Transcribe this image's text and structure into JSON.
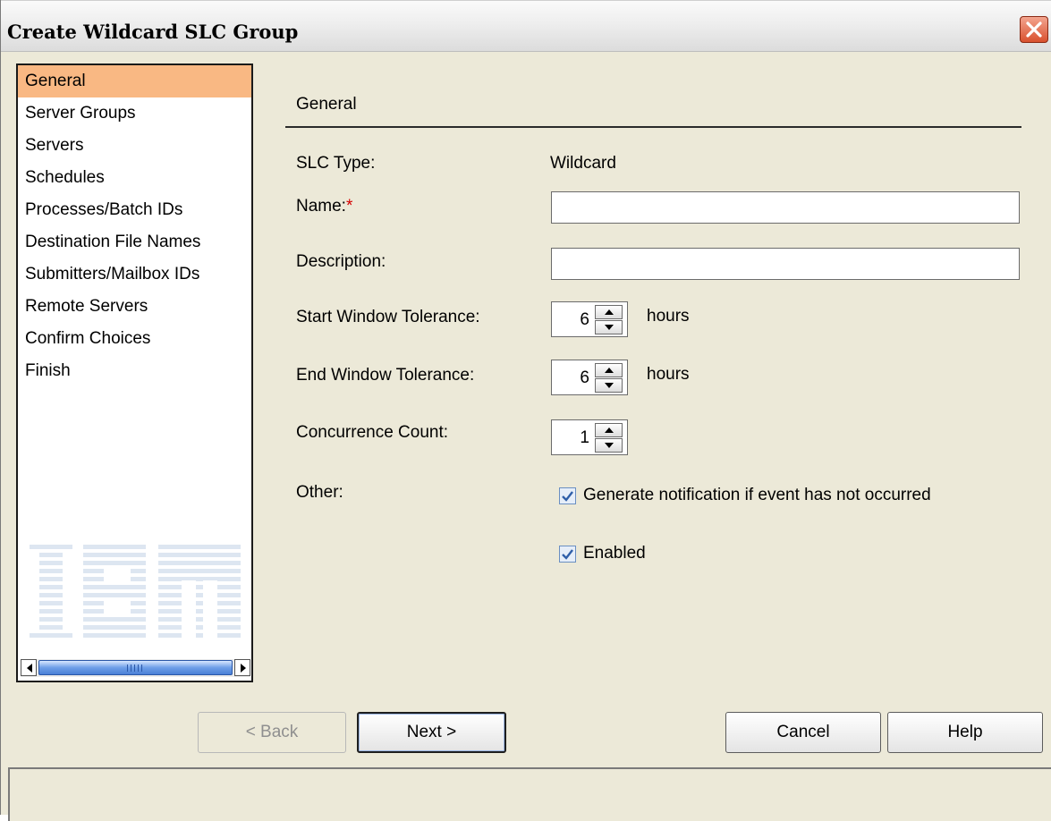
{
  "window": {
    "title": "Create Wildcard SLC Group",
    "close_icon": "close-icon"
  },
  "nav": {
    "items": [
      {
        "label": "General",
        "selected": true
      },
      {
        "label": "Server Groups"
      },
      {
        "label": "Servers"
      },
      {
        "label": "Schedules"
      },
      {
        "label": "Processes/Batch IDs"
      },
      {
        "label": "Destination File Names"
      },
      {
        "label": "Submitters/Mailbox IDs"
      },
      {
        "label": "Remote Servers"
      },
      {
        "label": "Confirm Choices"
      },
      {
        "label": "Finish"
      }
    ],
    "logo": "IBM",
    "selected_color": "#f9b883"
  },
  "form": {
    "section_title": "General",
    "slc_type_label": "SLC Type:",
    "slc_type_value": "Wildcard",
    "name_label": "Name:",
    "name_required_mark": "*",
    "name_value": "",
    "description_label": "Description:",
    "description_value": "",
    "start_tolerance_label": "Start Window Tolerance:",
    "start_tolerance_value": "6",
    "start_tolerance_unit": "hours",
    "end_tolerance_label": "End Window Tolerance:",
    "end_tolerance_value": "6",
    "end_tolerance_unit": "hours",
    "concurrence_label": "Concurrence Count:",
    "concurrence_value": "1",
    "other_label": "Other:",
    "generate_notification_label": "Generate notification if event has not occurred",
    "generate_notification_checked": true,
    "enabled_label": "Enabled",
    "enabled_checked": true
  },
  "buttons": {
    "back": "< Back",
    "next": "Next >",
    "cancel": "Cancel",
    "help": "Help"
  }
}
